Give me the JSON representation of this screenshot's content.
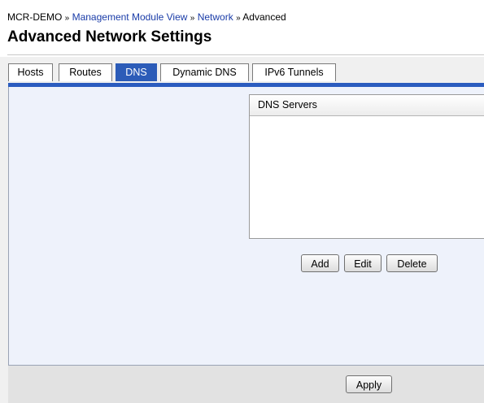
{
  "breadcrumb": {
    "root": "MCR-DEMO",
    "separator": "»",
    "items": [
      "Management Module View",
      "Network"
    ],
    "current": "Advanced"
  },
  "page": {
    "title": "Advanced Network Settings"
  },
  "tabs": [
    {
      "label": "Hosts",
      "active": false
    },
    {
      "label": "Routes",
      "active": false
    },
    {
      "label": "DNS",
      "active": true
    },
    {
      "label": "Dynamic DNS",
      "active": false
    },
    {
      "label": "IPv6 Tunnels",
      "active": false
    }
  ],
  "dns": {
    "header": "DNS Servers",
    "entries": [],
    "add_label": "Add",
    "edit_label": "Edit",
    "delete_label": "Delete"
  },
  "footer": {
    "apply_label": "Apply"
  },
  "colors": {
    "accent": "#2b5cbf",
    "link": "#1a3ca8",
    "panel": "#eef2fb"
  }
}
